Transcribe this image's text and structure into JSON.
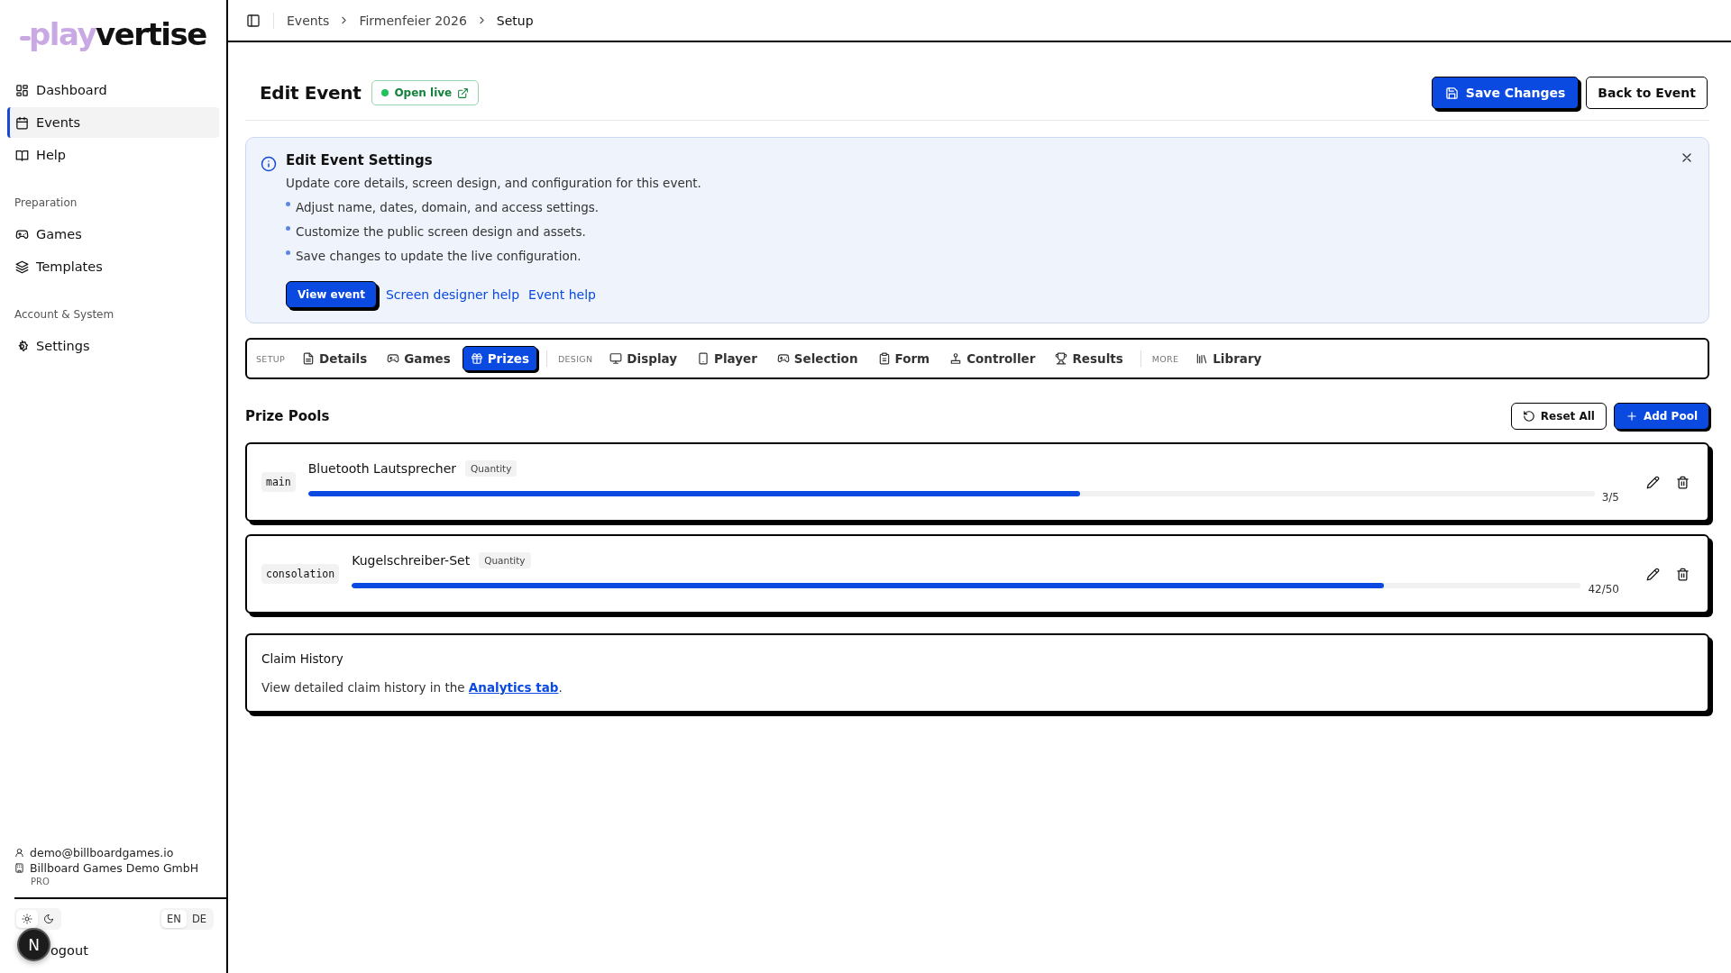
{
  "sidebar": {
    "logo": {
      "accent": "play",
      "text": "vertise"
    },
    "groups": [
      {
        "items": [
          {
            "label": "Dashboard",
            "selected": false
          },
          {
            "label": "Events",
            "selected": true
          },
          {
            "label": "Help",
            "selected": false
          }
        ]
      },
      {
        "title": "Preparation",
        "items": [
          {
            "label": "Games",
            "selected": false
          },
          {
            "label": "Templates",
            "selected": false
          }
        ]
      },
      {
        "title": "Account & System",
        "items": [
          {
            "label": "Settings",
            "selected": false
          }
        ]
      }
    ],
    "account": {
      "email": "demo@billboardgames.io",
      "company": "Billboard Games Demo GmbH",
      "plan": "PRO"
    },
    "theme": [
      {
        "kind": "light",
        "selected": true
      },
      {
        "kind": "dark",
        "selected": false
      }
    ],
    "languages": [
      {
        "label": "EN",
        "selected": true
      },
      {
        "label": "DE",
        "selected": false
      }
    ],
    "logout": "ogout",
    "dev_badge": "N"
  },
  "header": {
    "breadcrumbs": [
      "Events",
      "Firmenfeier 2026",
      "Setup"
    ]
  },
  "page": {
    "title": "Edit Event",
    "live_badge": "Open live",
    "save_button": "Save Changes",
    "back_button": "Back to Event"
  },
  "banner": {
    "title": "Edit Event Settings",
    "description": "Update core details, screen design, and configuration for this event.",
    "bullets": [
      "Adjust name, dates, domain, and access settings.",
      "Customize the public screen design and assets.",
      "Save changes to update the live configuration."
    ],
    "actions": [
      {
        "kind": "button",
        "label": "View event"
      },
      {
        "kind": "link",
        "label": "Screen designer help"
      },
      {
        "kind": "link",
        "label": "Event help"
      }
    ]
  },
  "tabs": [
    {
      "kind": "section",
      "label": "SETUP"
    },
    {
      "kind": "tab",
      "label": "Details",
      "selected": false
    },
    {
      "kind": "tab",
      "label": "Games",
      "selected": false
    },
    {
      "kind": "tab",
      "label": "Prizes",
      "selected": true
    },
    {
      "kind": "section",
      "label": "DESIGN"
    },
    {
      "kind": "tab",
      "label": "Display",
      "selected": false
    },
    {
      "kind": "tab",
      "label": "Player",
      "selected": false
    },
    {
      "kind": "tab",
      "label": "Selection",
      "selected": false
    },
    {
      "kind": "tab",
      "label": "Form",
      "selected": false
    },
    {
      "kind": "tab",
      "label": "Controller",
      "selected": false
    },
    {
      "kind": "tab",
      "label": "Results",
      "selected": false
    },
    {
      "kind": "section",
      "label": "MORE"
    },
    {
      "kind": "tab",
      "label": "Library",
      "selected": false
    }
  ],
  "prize_pools": {
    "heading": "Prize Pools",
    "reset_button": "Reset All",
    "add_button": "Add Pool",
    "pools": [
      {
        "tier": "main",
        "name": "Bluetooth Lautsprecher",
        "type": "Quantity",
        "level": 0.6,
        "reading": "3/5"
      },
      {
        "tier": "consolation",
        "name": "Kugelschreiber-Set",
        "type": "Quantity",
        "level": 0.84,
        "reading": "42/50"
      }
    ]
  },
  "claim_history": {
    "title": "Claim History",
    "text_before": "View detailed claim history in the ",
    "link": "Analytics tab",
    "text_after": "."
  }
}
